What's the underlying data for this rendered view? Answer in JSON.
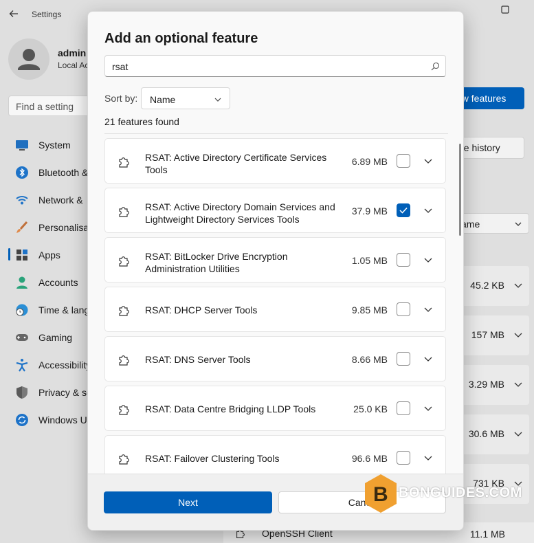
{
  "window": {
    "title": "Settings"
  },
  "user": {
    "name": "admin",
    "account_type": "Local Ac"
  },
  "search": {
    "placeholder": "Find a setting"
  },
  "sidebar": {
    "items": [
      {
        "label": "System",
        "icon": "system-icon"
      },
      {
        "label": "Bluetooth &",
        "icon": "bluetooth-icon"
      },
      {
        "label": "Network &",
        "icon": "network-icon"
      },
      {
        "label": "Personalisat",
        "icon": "brush-icon"
      },
      {
        "label": "Apps",
        "icon": "apps-icon"
      },
      {
        "label": "Accounts",
        "icon": "person-icon"
      },
      {
        "label": "Time & lang",
        "icon": "clock-globe-icon"
      },
      {
        "label": "Gaming",
        "icon": "gamepad-icon"
      },
      {
        "label": "Accessibility",
        "icon": "accessibility-icon"
      },
      {
        "label": "Privacy & se",
        "icon": "shield-icon"
      },
      {
        "label": "Windows U",
        "icon": "update-icon"
      }
    ],
    "active_index": 4
  },
  "right_panel": {
    "view_features_label": "ew features",
    "see_history_label": "ee history",
    "sort_label": "ame",
    "sizes": [
      "45.2 KB",
      "157 MB",
      "3.29 MB",
      "30.6 MB",
      "731 KB"
    ],
    "bottom_item": {
      "label": "OpenSSH Client",
      "size": "11.1 MB"
    }
  },
  "dialog": {
    "title": "Add an optional feature",
    "search_value": "rsat",
    "sort_by_label": "Sort by:",
    "sort_value": "Name",
    "count_text": "21 features found",
    "features": [
      {
        "name": "RSAT: Active Directory Certificate Services Tools",
        "size": "6.89 MB",
        "checked": false
      },
      {
        "name": "RSAT: Active Directory Domain Services and Lightweight Directory Services Tools",
        "size": "37.9 MB",
        "checked": true
      },
      {
        "name": "RSAT: BitLocker Drive Encryption Administration Utilities",
        "size": "1.05 MB",
        "checked": false
      },
      {
        "name": "RSAT: DHCP Server Tools",
        "size": "9.85 MB",
        "checked": false
      },
      {
        "name": "RSAT: DNS Server Tools",
        "size": "8.66 MB",
        "checked": false
      },
      {
        "name": "RSAT: Data Centre Bridging LLDP Tools",
        "size": "25.0 KB",
        "checked": false
      },
      {
        "name": "RSAT: Failover Clustering Tools",
        "size": "96.6 MB",
        "checked": false
      }
    ],
    "next_label": "Next",
    "cancel_label": "Cance"
  },
  "watermark": {
    "text": "BONGUIDES.COM",
    "logo_letter": "B"
  },
  "colors": {
    "accent": "#005fb8",
    "watermark": "#f0a030"
  }
}
